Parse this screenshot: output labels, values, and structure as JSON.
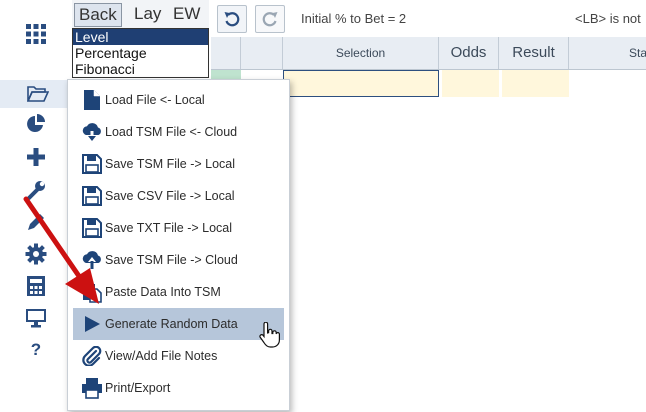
{
  "bet_tabs": {
    "back": "Back",
    "lay": "Lay",
    "ew": "EW"
  },
  "staking_list": {
    "options": [
      "Level",
      "Percentage",
      "Fibonacci"
    ],
    "selected": "Level"
  },
  "toolbar": {
    "initial_pct": "Initial % to Bet = 2",
    "lb_note": "<LB> is not"
  },
  "grid": {
    "columns": {
      "selection": "Selection",
      "odds": "Odds",
      "result": "Result",
      "stake": "Sta"
    }
  },
  "rail": {
    "icons": [
      "apps-grid-icon",
      "folder-open-icon",
      "pie-chart-icon",
      "plus-icon",
      "wrench-icon",
      "pencil-icon",
      "gear-icon",
      "calculator-icon",
      "monitor-icon",
      "help-icon"
    ]
  },
  "file_menu": {
    "items": [
      {
        "label": "Load File <- Local",
        "icon": "file-icon"
      },
      {
        "label": "Load TSM File <- Cloud",
        "icon": "cloud-download-icon"
      },
      {
        "label": "Save TSM File -> Local",
        "icon": "floppy-disk-icon"
      },
      {
        "label": "Save CSV File -> Local",
        "icon": "floppy-disk-icon"
      },
      {
        "label": "Save TXT File -> Local",
        "icon": "floppy-disk-icon"
      },
      {
        "label": "Save TSM File -> Cloud",
        "icon": "cloud-upload-icon"
      },
      {
        "label": "Paste Data Into TSM",
        "icon": "paste-icon"
      },
      {
        "label": "Generate Random Data",
        "icon": "play-icon"
      },
      {
        "label": "View/Add File Notes",
        "icon": "paperclip-icon"
      },
      {
        "label": "Print/Export",
        "icon": "printer-icon"
      }
    ],
    "hovered": "Generate Random Data"
  },
  "colors": {
    "icon_blue": "#2a4d80",
    "arrow_red": "#cc1111",
    "hover_bg": "#b6c6da",
    "list_selected": "#1f3f73"
  }
}
